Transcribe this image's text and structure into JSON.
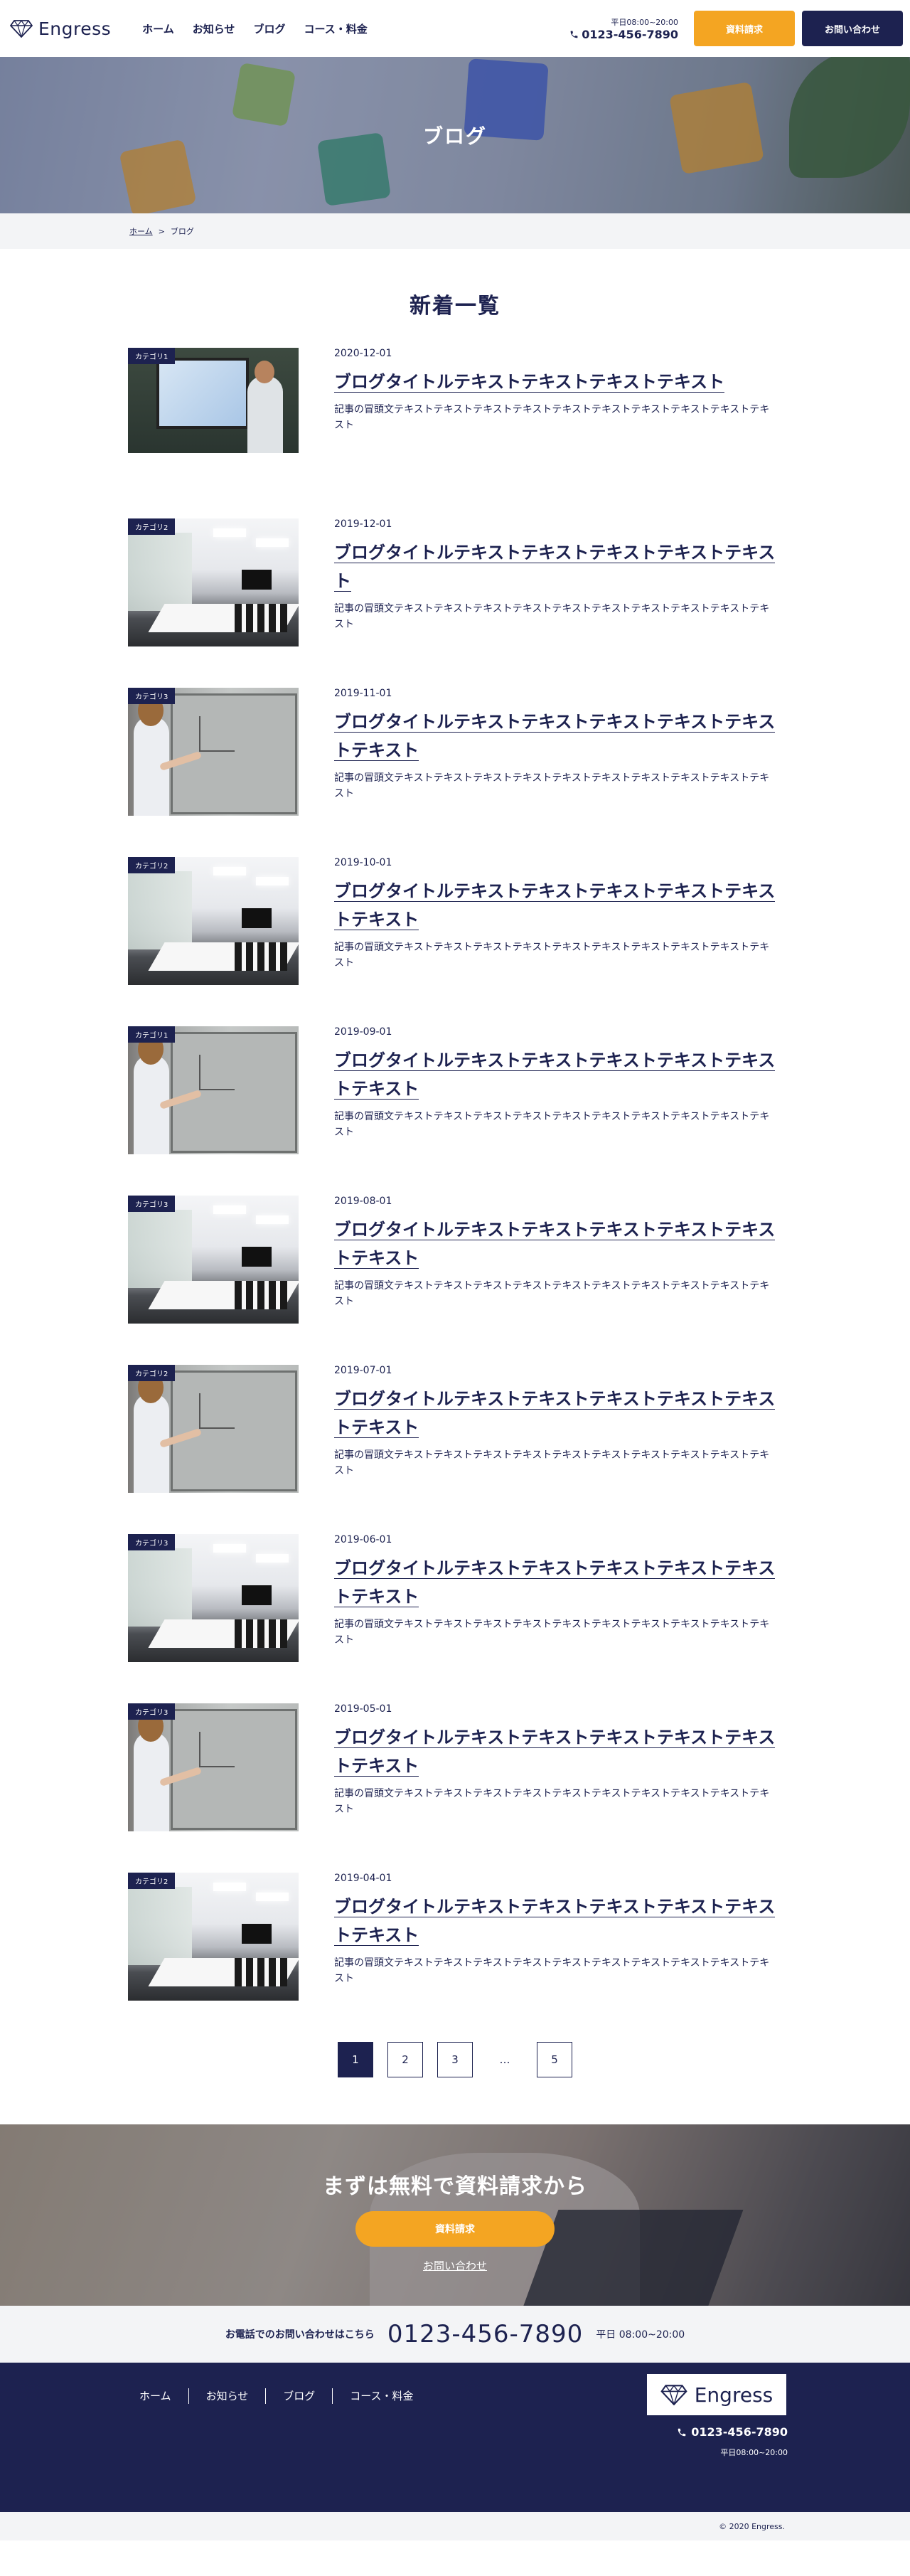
{
  "header": {
    "logo_text": "Engress",
    "nav": [
      "ホーム",
      "お知らせ",
      "ブログ",
      "コース・料金"
    ],
    "tel_hours": "平日08:00~20:00",
    "tel_number": "0123-456-7890",
    "doc_button": "資料請求",
    "contact_button": "お問い合わせ"
  },
  "hero": {
    "title": "ブログ"
  },
  "breadcrumb": {
    "home": "ホーム",
    "separator": ">",
    "current": "ブログ"
  },
  "main": {
    "title": "新着一覧"
  },
  "posts": [
    {
      "category": "カテゴリ1",
      "date": "2020-12-01",
      "title": "ブログタイトルテキストテキストテキストテキスト",
      "excerpt": "記事の冒頭文テキストテキストテキストテキストテキストテキストテキストテキストテキストテキスト",
      "photo": "presenter"
    },
    {
      "category": "カテゴリ2",
      "date": "2019-12-01",
      "title": "ブログタイトルテキストテキストテキストテキストテキスト",
      "excerpt": "記事の冒頭文テキストテキストテキストテキストテキストテキストテキストテキストテキストテキスト",
      "photo": "room"
    },
    {
      "category": "カテゴリ3",
      "date": "2019-11-01",
      "title": "ブログタイトルテキストテキストテキストテキストテキストテキスト",
      "excerpt": "記事の冒頭文テキストテキストテキストテキストテキストテキストテキストテキストテキストテキスト",
      "photo": "board"
    },
    {
      "category": "カテゴリ2",
      "date": "2019-10-01",
      "title": "ブログタイトルテキストテキストテキストテキストテキストテキスト",
      "excerpt": "記事の冒頭文テキストテキストテキストテキストテキストテキストテキストテキストテキストテキスト",
      "photo": "room"
    },
    {
      "category": "カテゴリ1",
      "date": "2019-09-01",
      "title": "ブログタイトルテキストテキストテキストテキストテキストテキスト",
      "excerpt": "記事の冒頭文テキストテキストテキストテキストテキストテキストテキストテキストテキストテキスト",
      "photo": "board"
    },
    {
      "category": "カテゴリ3",
      "date": "2019-08-01",
      "title": "ブログタイトルテキストテキストテキストテキストテキストテキスト",
      "excerpt": "記事の冒頭文テキストテキストテキストテキストテキストテキストテキストテキストテキストテキスト",
      "photo": "room"
    },
    {
      "category": "カテゴリ2",
      "date": "2019-07-01",
      "title": "ブログタイトルテキストテキストテキストテキストテキストテキスト",
      "excerpt": "記事の冒頭文テキストテキストテキストテキストテキストテキストテキストテキストテキストテキスト",
      "photo": "board"
    },
    {
      "category": "カテゴリ3",
      "date": "2019-06-01",
      "title": "ブログタイトルテキストテキストテキストテキストテキストテキスト",
      "excerpt": "記事の冒頭文テキストテキストテキストテキストテキストテキストテキストテキストテキストテキスト",
      "photo": "room"
    },
    {
      "category": "カテゴリ3",
      "date": "2019-05-01",
      "title": "ブログタイトルテキストテキストテキストテキストテキストテキスト",
      "excerpt": "記事の冒頭文テキストテキストテキストテキストテキストテキストテキストテキストテキストテキスト",
      "photo": "board"
    },
    {
      "category": "カテゴリ2",
      "date": "2019-04-01",
      "title": "ブログタイトルテキストテキストテキストテキストテキストテキスト",
      "excerpt": "記事の冒頭文テキストテキストテキストテキストテキストテキストテキストテキストテキストテキスト",
      "photo": "room"
    }
  ],
  "pagination": {
    "pages": [
      "1",
      "2",
      "3"
    ],
    "ellipsis": "…",
    "last": "5",
    "current": "1"
  },
  "cta": {
    "title": "まずは無料で資料請求から",
    "button": "資料請求",
    "link": "お問い合わせ"
  },
  "telband": {
    "label": "お電話でのお問い合わせはこちら",
    "number": "0123-456-7890",
    "hours": "平日 08:00~20:00"
  },
  "footer": {
    "nav": [
      "ホーム",
      "お知らせ",
      "ブログ",
      "コース・料金"
    ],
    "logo_text": "Engress",
    "tel_number": "0123-456-7890",
    "tel_hours": "平日08:00~20:00",
    "copyright": "© 2020 Engress."
  },
  "colors": {
    "navy": "#1d2250",
    "accent": "#f4a522",
    "light_gray": "#f3f4f6"
  },
  "icons": {
    "logo": "diamond-icon",
    "tel": "phone-icon"
  }
}
